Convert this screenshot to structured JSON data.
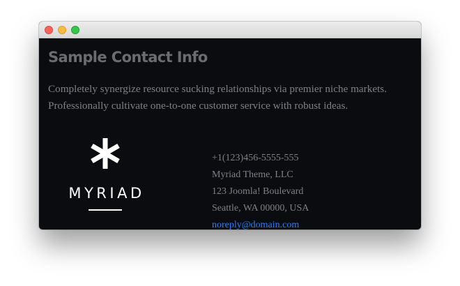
{
  "window": {
    "controls": {
      "close_icon": "close-traffic-light",
      "minimize_icon": "minimize-traffic-light",
      "zoom_icon": "zoom-traffic-light"
    }
  },
  "content": {
    "title": "Sample Contact Info",
    "description": "Completely synergize resource sucking relationships via premier niche markets. Professionally cultivate one-to-one customer service with robust ideas."
  },
  "logo": {
    "icon": "asterisk-icon",
    "wordmark": "MYRIAD"
  },
  "contact": {
    "phone": "+1(123)456-5555-555",
    "company": "Myriad Theme, LLC",
    "street": "123 Joomla! Boulevard",
    "city": "Seattle, WA 00000, USA",
    "email": "noreply@domain.com"
  },
  "colors": {
    "background": "#0a0c0f",
    "title": "#6a6c70",
    "text": "#7d8087",
    "link": "#2f7cf6",
    "logo": "#ffffff"
  }
}
